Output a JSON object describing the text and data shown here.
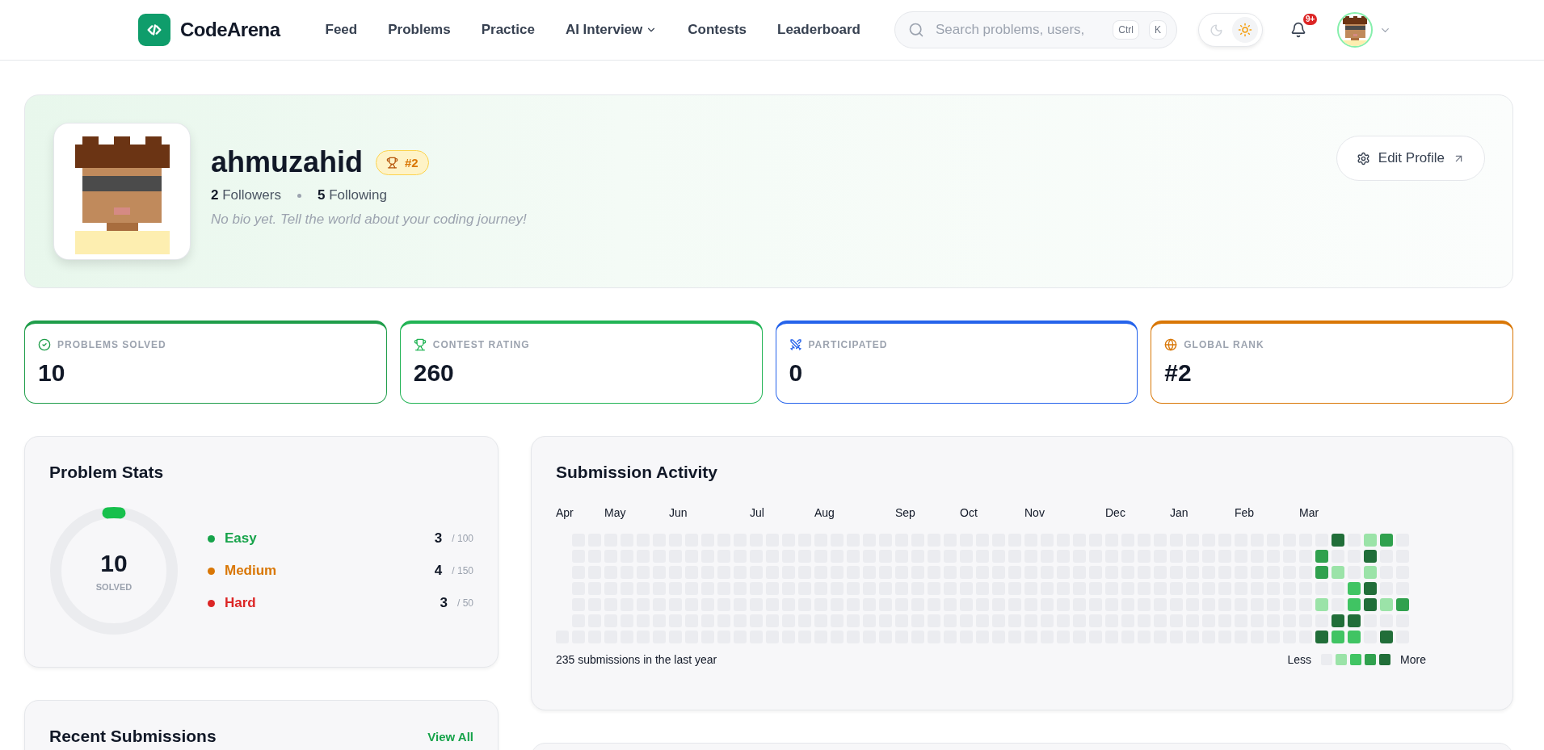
{
  "header": {
    "logo": "CodeArena",
    "nav": [
      {
        "label": "Feed",
        "has_menu": false
      },
      {
        "label": "Problems",
        "has_menu": false
      },
      {
        "label": "Practice",
        "has_menu": false
      },
      {
        "label": "AI Interview",
        "has_menu": true
      },
      {
        "label": "Contests",
        "has_menu": false
      },
      {
        "label": "Leaderboard",
        "has_menu": false
      }
    ],
    "search": {
      "placeholder": "Search problems, users,",
      "keys": [
        "Ctrl",
        "K"
      ]
    },
    "theme_toggle": [
      {
        "kind": "moon",
        "selected": false
      },
      {
        "kind": "sun",
        "selected": true
      }
    ],
    "notifications": {
      "badge": "9+"
    }
  },
  "profile": {
    "username": "ahmuzahid",
    "rank_badge": "#2",
    "followers": "**2** Followers",
    "following": "**5** Following",
    "bio": "No bio yet. Tell the world about your coding journey!",
    "edit_button": "Edit Profile"
  },
  "stats": [
    {
      "kind": "check",
      "label": "PROBLEMS SOLVED",
      "value": "10",
      "color": "#1f9d4a"
    },
    {
      "kind": "trophy",
      "label": "CONTEST RATING",
      "value": "260",
      "color": "#22b455"
    },
    {
      "kind": "swords",
      "label": "PARTICIPATED",
      "value": "0",
      "color": "#2563eb"
    },
    {
      "kind": "globe",
      "label": "GLOBAL RANK",
      "value": "#2",
      "color": "#d97706"
    }
  ],
  "problem_stats": {
    "title": "Problem Stats",
    "solved": "10",
    "solved_label": "SOLVED",
    "rows": [
      {
        "label": "Easy",
        "count": "3",
        "total": "/ 100",
        "color": "#16a34a"
      },
      {
        "label": "Medium",
        "count": "4",
        "total": "/ 150",
        "color": "#d97706"
      },
      {
        "label": "Hard",
        "count": "3",
        "total": "/ 50",
        "color": "#dc2626"
      }
    ]
  },
  "recent_submissions": {
    "title": "Recent Submissions",
    "link": "View All"
  },
  "activity": {
    "title": "Submission Activity",
    "summary": "235 submissions in the last year",
    "less": "Less",
    "more": "More",
    "legend": [
      {
        "color": "#ebecf0"
      },
      {
        "color": "#9be3a8"
      },
      {
        "color": "#40c463"
      },
      {
        "color": "#30a14e"
      },
      {
        "color": "#216e39"
      }
    ],
    "weeks": [
      {
        "month": "Apr",
        "days": [
          {
            "color": "#ebecf0"
          }
        ]
      },
      {
        "days": [
          {
            "color": "#ebecf0"
          },
          {
            "color": "#ebecf0"
          },
          {
            "color": "#ebecf0"
          },
          {
            "color": "#ebecf0"
          },
          {
            "color": "#ebecf0"
          },
          {
            "color": "#ebecf0"
          },
          {
            "color": "#ebecf0"
          }
        ]
      },
      {
        "days": [
          {
            "color": "#ebecf0"
          },
          {
            "color": "#ebecf0"
          },
          {
            "color": "#ebecf0"
          },
          {
            "color": "#ebecf0"
          },
          {
            "color": "#ebecf0"
          },
          {
            "color": "#ebecf0"
          },
          {
            "color": "#ebecf0"
          }
        ]
      },
      {
        "month": "May",
        "days": [
          {
            "color": "#ebecf0"
          },
          {
            "color": "#ebecf0"
          },
          {
            "color": "#ebecf0"
          },
          {
            "color": "#ebecf0"
          },
          {
            "color": "#ebecf0"
          },
          {
            "color": "#ebecf0"
          },
          {
            "color": "#ebecf0"
          }
        ]
      },
      {
        "days": [
          {
            "color": "#ebecf0"
          },
          {
            "color": "#ebecf0"
          },
          {
            "color": "#ebecf0"
          },
          {
            "color": "#ebecf0"
          },
          {
            "color": "#ebecf0"
          },
          {
            "color": "#ebecf0"
          },
          {
            "color": "#ebecf0"
          }
        ]
      },
      {
        "days": [
          {
            "color": "#ebecf0"
          },
          {
            "color": "#ebecf0"
          },
          {
            "color": "#ebecf0"
          },
          {
            "color": "#ebecf0"
          },
          {
            "color": "#ebecf0"
          },
          {
            "color": "#ebecf0"
          },
          {
            "color": "#ebecf0"
          }
        ]
      },
      {
        "days": [
          {
            "color": "#ebecf0"
          },
          {
            "color": "#ebecf0"
          },
          {
            "color": "#ebecf0"
          },
          {
            "color": "#ebecf0"
          },
          {
            "color": "#ebecf0"
          },
          {
            "color": "#ebecf0"
          },
          {
            "color": "#ebecf0"
          }
        ]
      },
      {
        "month": "Jun",
        "days": [
          {
            "color": "#ebecf0"
          },
          {
            "color": "#ebecf0"
          },
          {
            "color": "#ebecf0"
          },
          {
            "color": "#ebecf0"
          },
          {
            "color": "#ebecf0"
          },
          {
            "color": "#ebecf0"
          },
          {
            "color": "#ebecf0"
          }
        ]
      },
      {
        "days": [
          {
            "color": "#ebecf0"
          },
          {
            "color": "#ebecf0"
          },
          {
            "color": "#ebecf0"
          },
          {
            "color": "#ebecf0"
          },
          {
            "color": "#ebecf0"
          },
          {
            "color": "#ebecf0"
          },
          {
            "color": "#ebecf0"
          }
        ]
      },
      {
        "days": [
          {
            "color": "#ebecf0"
          },
          {
            "color": "#ebecf0"
          },
          {
            "color": "#ebecf0"
          },
          {
            "color": "#ebecf0"
          },
          {
            "color": "#ebecf0"
          },
          {
            "color": "#ebecf0"
          },
          {
            "color": "#ebecf0"
          }
        ]
      },
      {
        "days": [
          {
            "color": "#ebecf0"
          },
          {
            "color": "#ebecf0"
          },
          {
            "color": "#ebecf0"
          },
          {
            "color": "#ebecf0"
          },
          {
            "color": "#ebecf0"
          },
          {
            "color": "#ebecf0"
          },
          {
            "color": "#ebecf0"
          }
        ]
      },
      {
        "days": [
          {
            "color": "#ebecf0"
          },
          {
            "color": "#ebecf0"
          },
          {
            "color": "#ebecf0"
          },
          {
            "color": "#ebecf0"
          },
          {
            "color": "#ebecf0"
          },
          {
            "color": "#ebecf0"
          },
          {
            "color": "#ebecf0"
          }
        ]
      },
      {
        "month": "Jul",
        "days": [
          {
            "color": "#ebecf0"
          },
          {
            "color": "#ebecf0"
          },
          {
            "color": "#ebecf0"
          },
          {
            "color": "#ebecf0"
          },
          {
            "color": "#ebecf0"
          },
          {
            "color": "#ebecf0"
          },
          {
            "color": "#ebecf0"
          }
        ]
      },
      {
        "days": [
          {
            "color": "#ebecf0"
          },
          {
            "color": "#ebecf0"
          },
          {
            "color": "#ebecf0"
          },
          {
            "color": "#ebecf0"
          },
          {
            "color": "#ebecf0"
          },
          {
            "color": "#ebecf0"
          },
          {
            "color": "#ebecf0"
          }
        ]
      },
      {
        "days": [
          {
            "color": "#ebecf0"
          },
          {
            "color": "#ebecf0"
          },
          {
            "color": "#ebecf0"
          },
          {
            "color": "#ebecf0"
          },
          {
            "color": "#ebecf0"
          },
          {
            "color": "#ebecf0"
          },
          {
            "color": "#ebecf0"
          }
        ]
      },
      {
        "days": [
          {
            "color": "#ebecf0"
          },
          {
            "color": "#ebecf0"
          },
          {
            "color": "#ebecf0"
          },
          {
            "color": "#ebecf0"
          },
          {
            "color": "#ebecf0"
          },
          {
            "color": "#ebecf0"
          },
          {
            "color": "#ebecf0"
          }
        ]
      },
      {
        "month": "Aug",
        "days": [
          {
            "color": "#ebecf0"
          },
          {
            "color": "#ebecf0"
          },
          {
            "color": "#ebecf0"
          },
          {
            "color": "#ebecf0"
          },
          {
            "color": "#ebecf0"
          },
          {
            "color": "#ebecf0"
          },
          {
            "color": "#ebecf0"
          }
        ]
      },
      {
        "days": [
          {
            "color": "#ebecf0"
          },
          {
            "color": "#ebecf0"
          },
          {
            "color": "#ebecf0"
          },
          {
            "color": "#ebecf0"
          },
          {
            "color": "#ebecf0"
          },
          {
            "color": "#ebecf0"
          },
          {
            "color": "#ebecf0"
          }
        ]
      },
      {
        "days": [
          {
            "color": "#ebecf0"
          },
          {
            "color": "#ebecf0"
          },
          {
            "color": "#ebecf0"
          },
          {
            "color": "#ebecf0"
          },
          {
            "color": "#ebecf0"
          },
          {
            "color": "#ebecf0"
          },
          {
            "color": "#ebecf0"
          }
        ]
      },
      {
        "days": [
          {
            "color": "#ebecf0"
          },
          {
            "color": "#ebecf0"
          },
          {
            "color": "#ebecf0"
          },
          {
            "color": "#ebecf0"
          },
          {
            "color": "#ebecf0"
          },
          {
            "color": "#ebecf0"
          },
          {
            "color": "#ebecf0"
          }
        ]
      },
      {
        "days": [
          {
            "color": "#ebecf0"
          },
          {
            "color": "#ebecf0"
          },
          {
            "color": "#ebecf0"
          },
          {
            "color": "#ebecf0"
          },
          {
            "color": "#ebecf0"
          },
          {
            "color": "#ebecf0"
          },
          {
            "color": "#ebecf0"
          }
        ]
      },
      {
        "month": "Sep",
        "days": [
          {
            "color": "#ebecf0"
          },
          {
            "color": "#ebecf0"
          },
          {
            "color": "#ebecf0"
          },
          {
            "color": "#ebecf0"
          },
          {
            "color": "#ebecf0"
          },
          {
            "color": "#ebecf0"
          },
          {
            "color": "#ebecf0"
          }
        ]
      },
      {
        "days": [
          {
            "color": "#ebecf0"
          },
          {
            "color": "#ebecf0"
          },
          {
            "color": "#ebecf0"
          },
          {
            "color": "#ebecf0"
          },
          {
            "color": "#ebecf0"
          },
          {
            "color": "#ebecf0"
          },
          {
            "color": "#ebecf0"
          }
        ]
      },
      {
        "days": [
          {
            "color": "#ebecf0"
          },
          {
            "color": "#ebecf0"
          },
          {
            "color": "#ebecf0"
          },
          {
            "color": "#ebecf0"
          },
          {
            "color": "#ebecf0"
          },
          {
            "color": "#ebecf0"
          },
          {
            "color": "#ebecf0"
          }
        ]
      },
      {
        "days": [
          {
            "color": "#ebecf0"
          },
          {
            "color": "#ebecf0"
          },
          {
            "color": "#ebecf0"
          },
          {
            "color": "#ebecf0"
          },
          {
            "color": "#ebecf0"
          },
          {
            "color": "#ebecf0"
          },
          {
            "color": "#ebecf0"
          }
        ]
      },
      {
        "month": "Oct",
        "days": [
          {
            "color": "#ebecf0"
          },
          {
            "color": "#ebecf0"
          },
          {
            "color": "#ebecf0"
          },
          {
            "color": "#ebecf0"
          },
          {
            "color": "#ebecf0"
          },
          {
            "color": "#ebecf0"
          },
          {
            "color": "#ebecf0"
          }
        ]
      },
      {
        "days": [
          {
            "color": "#ebecf0"
          },
          {
            "color": "#ebecf0"
          },
          {
            "color": "#ebecf0"
          },
          {
            "color": "#ebecf0"
          },
          {
            "color": "#ebecf0"
          },
          {
            "color": "#ebecf0"
          },
          {
            "color": "#ebecf0"
          }
        ]
      },
      {
        "days": [
          {
            "color": "#ebecf0"
          },
          {
            "color": "#ebecf0"
          },
          {
            "color": "#ebecf0"
          },
          {
            "color": "#ebecf0"
          },
          {
            "color": "#ebecf0"
          },
          {
            "color": "#ebecf0"
          },
          {
            "color": "#ebecf0"
          }
        ]
      },
      {
        "days": [
          {
            "color": "#ebecf0"
          },
          {
            "color": "#ebecf0"
          },
          {
            "color": "#ebecf0"
          },
          {
            "color": "#ebecf0"
          },
          {
            "color": "#ebecf0"
          },
          {
            "color": "#ebecf0"
          },
          {
            "color": "#ebecf0"
          }
        ]
      },
      {
        "month": "Nov",
        "days": [
          {
            "color": "#ebecf0"
          },
          {
            "color": "#ebecf0"
          },
          {
            "color": "#ebecf0"
          },
          {
            "color": "#ebecf0"
          },
          {
            "color": "#ebecf0"
          },
          {
            "color": "#ebecf0"
          },
          {
            "color": "#ebecf0"
          }
        ]
      },
      {
        "days": [
          {
            "color": "#ebecf0"
          },
          {
            "color": "#ebecf0"
          },
          {
            "color": "#ebecf0"
          },
          {
            "color": "#ebecf0"
          },
          {
            "color": "#ebecf0"
          },
          {
            "color": "#ebecf0"
          },
          {
            "color": "#ebecf0"
          }
        ]
      },
      {
        "days": [
          {
            "color": "#ebecf0"
          },
          {
            "color": "#ebecf0"
          },
          {
            "color": "#ebecf0"
          },
          {
            "color": "#ebecf0"
          },
          {
            "color": "#ebecf0"
          },
          {
            "color": "#ebecf0"
          },
          {
            "color": "#ebecf0"
          }
        ]
      },
      {
        "days": [
          {
            "color": "#ebecf0"
          },
          {
            "color": "#ebecf0"
          },
          {
            "color": "#ebecf0"
          },
          {
            "color": "#ebecf0"
          },
          {
            "color": "#ebecf0"
          },
          {
            "color": "#ebecf0"
          },
          {
            "color": "#ebecf0"
          }
        ]
      },
      {
        "days": [
          {
            "color": "#ebecf0"
          },
          {
            "color": "#ebecf0"
          },
          {
            "color": "#ebecf0"
          },
          {
            "color": "#ebecf0"
          },
          {
            "color": "#ebecf0"
          },
          {
            "color": "#ebecf0"
          },
          {
            "color": "#ebecf0"
          }
        ]
      },
      {
        "month": "Dec",
        "days": [
          {
            "color": "#ebecf0"
          },
          {
            "color": "#ebecf0"
          },
          {
            "color": "#ebecf0"
          },
          {
            "color": "#ebecf0"
          },
          {
            "color": "#ebecf0"
          },
          {
            "color": "#ebecf0"
          },
          {
            "color": "#ebecf0"
          }
        ]
      },
      {
        "days": [
          {
            "color": "#ebecf0"
          },
          {
            "color": "#ebecf0"
          },
          {
            "color": "#ebecf0"
          },
          {
            "color": "#ebecf0"
          },
          {
            "color": "#ebecf0"
          },
          {
            "color": "#ebecf0"
          },
          {
            "color": "#ebecf0"
          }
        ]
      },
      {
        "days": [
          {
            "color": "#ebecf0"
          },
          {
            "color": "#ebecf0"
          },
          {
            "color": "#ebecf0"
          },
          {
            "color": "#ebecf0"
          },
          {
            "color": "#ebecf0"
          },
          {
            "color": "#ebecf0"
          },
          {
            "color": "#ebecf0"
          }
        ]
      },
      {
        "days": [
          {
            "color": "#ebecf0"
          },
          {
            "color": "#ebecf0"
          },
          {
            "color": "#ebecf0"
          },
          {
            "color": "#ebecf0"
          },
          {
            "color": "#ebecf0"
          },
          {
            "color": "#ebecf0"
          },
          {
            "color": "#ebecf0"
          }
        ]
      },
      {
        "month": "Jan",
        "days": [
          {
            "color": "#ebecf0"
          },
          {
            "color": "#ebecf0"
          },
          {
            "color": "#ebecf0"
          },
          {
            "color": "#ebecf0"
          },
          {
            "color": "#ebecf0"
          },
          {
            "color": "#ebecf0"
          },
          {
            "color": "#ebecf0"
          }
        ]
      },
      {
        "days": [
          {
            "color": "#ebecf0"
          },
          {
            "color": "#ebecf0"
          },
          {
            "color": "#ebecf0"
          },
          {
            "color": "#ebecf0"
          },
          {
            "color": "#ebecf0"
          },
          {
            "color": "#ebecf0"
          },
          {
            "color": "#ebecf0"
          }
        ]
      },
      {
        "days": [
          {
            "color": "#ebecf0"
          },
          {
            "color": "#ebecf0"
          },
          {
            "color": "#ebecf0"
          },
          {
            "color": "#ebecf0"
          },
          {
            "color": "#ebecf0"
          },
          {
            "color": "#ebecf0"
          },
          {
            "color": "#ebecf0"
          }
        ]
      },
      {
        "days": [
          {
            "color": "#ebecf0"
          },
          {
            "color": "#ebecf0"
          },
          {
            "color": "#ebecf0"
          },
          {
            "color": "#ebecf0"
          },
          {
            "color": "#ebecf0"
          },
          {
            "color": "#ebecf0"
          },
          {
            "color": "#ebecf0"
          }
        ]
      },
      {
        "month": "Feb",
        "days": [
          {
            "color": "#ebecf0"
          },
          {
            "color": "#ebecf0"
          },
          {
            "color": "#ebecf0"
          },
          {
            "color": "#ebecf0"
          },
          {
            "color": "#ebecf0"
          },
          {
            "color": "#ebecf0"
          },
          {
            "color": "#ebecf0"
          }
        ]
      },
      {
        "days": [
          {
            "color": "#ebecf0"
          },
          {
            "color": "#ebecf0"
          },
          {
            "color": "#ebecf0"
          },
          {
            "color": "#ebecf0"
          },
          {
            "color": "#ebecf0"
          },
          {
            "color": "#ebecf0"
          },
          {
            "color": "#ebecf0"
          }
        ]
      },
      {
        "days": [
          {
            "color": "#ebecf0"
          },
          {
            "color": "#ebecf0"
          },
          {
            "color": "#ebecf0"
          },
          {
            "color": "#ebecf0"
          },
          {
            "color": "#ebecf0"
          },
          {
            "color": "#ebecf0"
          },
          {
            "color": "#ebecf0"
          }
        ]
      },
      {
        "days": [
          {
            "color": "#ebecf0"
          },
          {
            "color": "#ebecf0"
          },
          {
            "color": "#ebecf0"
          },
          {
            "color": "#ebecf0"
          },
          {
            "color": "#ebecf0"
          },
          {
            "color": "#ebecf0"
          },
          {
            "color": "#ebecf0"
          }
        ]
      },
      {
        "month": "Mar",
        "days": [
          {
            "color": "#ebecf0"
          },
          {
            "color": "#ebecf0"
          },
          {
            "color": "#ebecf0"
          },
          {
            "color": "#ebecf0"
          },
          {
            "color": "#ebecf0"
          },
          {
            "color": "#ebecf0"
          },
          {
            "color": "#ebecf0"
          }
        ]
      },
      {
        "days": [
          {
            "color": "#ebecf0"
          },
          {
            "color": "#30a14e"
          },
          {
            "color": "#30a14e"
          },
          {
            "color": "#ebecf0"
          },
          {
            "color": "#9be3a8"
          },
          {
            "color": "#ebecf0"
          },
          {
            "color": "#216e39"
          }
        ]
      },
      {
        "days": [
          {
            "color": "#216e39"
          },
          {
            "color": "#ebecf0"
          },
          {
            "color": "#9be3a8"
          },
          {
            "color": "#ebecf0"
          },
          {
            "color": "#ebecf0"
          },
          {
            "color": "#216e39"
          },
          {
            "color": "#40c463"
          }
        ]
      },
      {
        "days": [
          {
            "color": "#ebecf0"
          },
          {
            "color": "#ebecf0"
          },
          {
            "color": "#ebecf0"
          },
          {
            "color": "#40c463"
          },
          {
            "color": "#40c463"
          },
          {
            "color": "#216e39"
          },
          {
            "color": "#40c463"
          }
        ]
      },
      {
        "days": [
          {
            "color": "#9be3a8"
          },
          {
            "color": "#216e39"
          },
          {
            "color": "#9be3a8"
          },
          {
            "color": "#216e39"
          },
          {
            "color": "#216e39"
          },
          {
            "color": "#ebecf0"
          },
          {
            "color": "#ebecf0"
          }
        ]
      },
      {
        "days": [
          {
            "color": "#30a14e"
          },
          {
            "color": "#ebecf0"
          },
          {
            "color": "#ebecf0"
          },
          {
            "color": "#ebecf0"
          },
          {
            "color": "#9be3a8"
          },
          {
            "color": "#ebecf0"
          },
          {
            "color": "#216e39"
          }
        ]
      },
      {
        "days": [
          {
            "color": "#ebecf0"
          },
          {
            "color": "#ebecf0"
          },
          {
            "color": "#ebecf0"
          },
          {
            "color": "#ebecf0"
          },
          {
            "color": "#30a14e"
          },
          {
            "color": "#ebecf0"
          },
          {
            "color": "#ebecf0"
          }
        ]
      }
    ]
  }
}
